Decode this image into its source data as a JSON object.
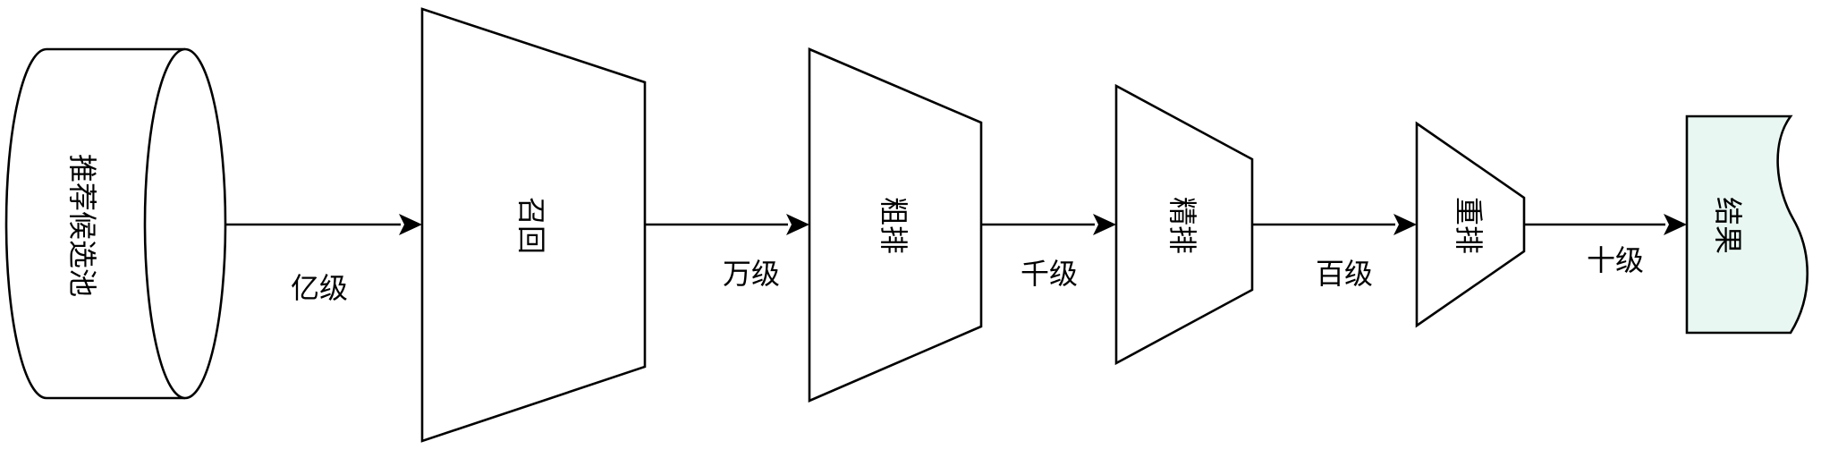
{
  "nodes": {
    "pool": "推荐候选池",
    "recall": "召回",
    "coarse": "粗排",
    "fine": "精排",
    "rerank": "重排",
    "result": "结果"
  },
  "edges": {
    "e1": "亿级",
    "e2": "万级",
    "e3": "千级",
    "e4": "百级",
    "e5": "十级"
  },
  "colors": {
    "stroke": "#000000",
    "node_fill": "#ffffff",
    "result_fill": "#e9f7f2"
  }
}
